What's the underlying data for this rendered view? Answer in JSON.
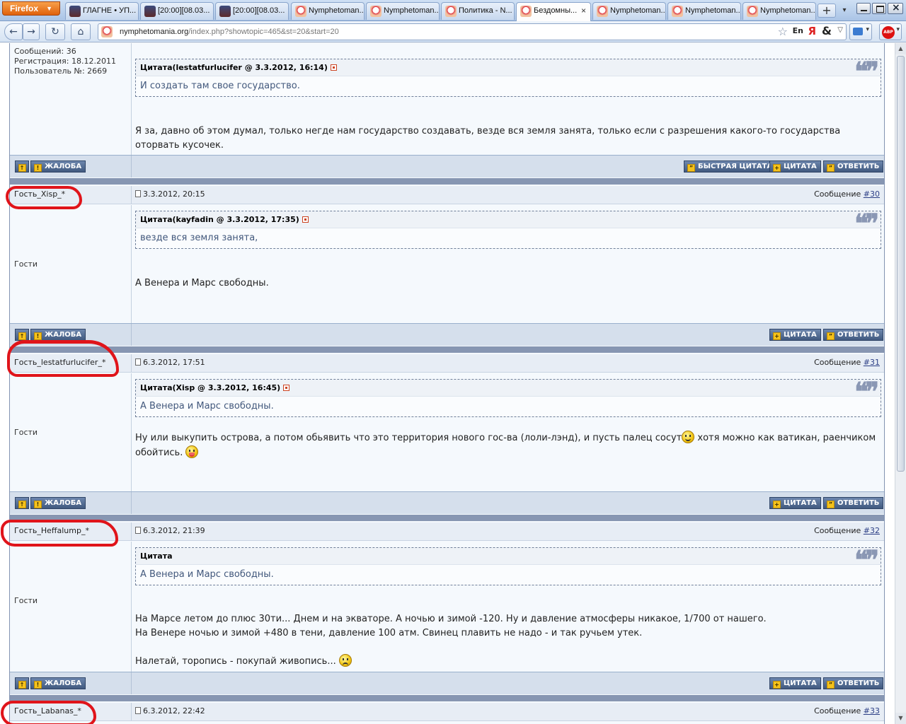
{
  "browser": {
    "firefox_label": "Firefox",
    "tabs": [
      {
        "label": "ГЛАГНЕ • УП...",
        "icon": "dark"
      },
      {
        "label": "[20:00][08.03...",
        "icon": "dark"
      },
      {
        "label": "[20:00][08.03...",
        "icon": "dark"
      },
      {
        "label": "Nymphetoman...",
        "icon": "nym"
      },
      {
        "label": "Nymphetoman...",
        "icon": "nym"
      },
      {
        "label": "Политика - N...",
        "icon": "nym"
      },
      {
        "label": "Бездомны...",
        "icon": "nym",
        "active": true
      },
      {
        "label": "Nymphetoman...",
        "icon": "nym"
      },
      {
        "label": "Nymphetoman...",
        "icon": "nym"
      },
      {
        "label": "Nymphetoman...",
        "icon": "nym"
      }
    ],
    "url_host": "nymphetomania.org",
    "url_path": "/index.php?showtopic=465&st=20&start=20",
    "en_label": "En"
  },
  "forum": {
    "prev_author": {
      "posts": "Сообщений: 36",
      "registered": "Регистрация: 18.12.2011",
      "user_no": "Пользователь №: 2669"
    },
    "prev_quote_head": "Цитата(lestatfurlucifer @ 3.3.2012, 16:14)",
    "prev_quote_text": "И создать там свое государство.",
    "prev_message": "Я за, давно об этом думал, только негде нам государство создавать, везде вся земля занята, только если с разрешения какого-то государства оторвать кусочек.",
    "buttons": {
      "report": "ЖАЛОБА",
      "fast_quote": "БЫСТРАЯ ЦИТАТА",
      "quote": "ЦИТАТА",
      "reply": "ОТВЕТИТЬ"
    },
    "group_label": "Гости",
    "message_label": "Сообщение",
    "posts": [
      {
        "author": "Гость_Xisp_*",
        "date": "3.3.2012, 20:15",
        "number": "#30",
        "quote_head": "Цитата(kayfadin @ 3.3.2012, 17:35)",
        "quote_text": "везде вся земля занята,",
        "message": "А Венера и Марс свободны."
      },
      {
        "author": "Гость_lestatfurlucifer_*",
        "date": "6.3.2012, 17:51",
        "number": "#31",
        "quote_head": "Цитата(Xisp @ 3.3.2012, 16:45)",
        "quote_text": "А Венера и Марс свободны.",
        "message_line1": "Ну или выкупить острова, а потом обьявить что это территория нового гос-ва (лоли-лэнд), и пусть палец сосут",
        "message_line1b": " хотя можно как ватикан, раенчиком",
        "message_line2": "обойтись. "
      },
      {
        "author": "Гость_Heffalump_*",
        "date": "6.3.2012, 21:39",
        "number": "#32",
        "quote_head": "Цитата",
        "quote_text": "А Венера и Марс свободны.",
        "message_line1": "На Марсе летом до плюс 30ти... Днем и на экваторе. А ночью и зимой -120. Ну и давление атмосферы никакое, 1/700 от нашего.",
        "message_line2": "На Венере ночью и зимой +480 в тени, давление 100 атм. Свинец плавить не надо - и так ручьем утек.",
        "message_line3": "Налетай, торопись - покупай живопись... "
      },
      {
        "author": "Гость_Labanas_*",
        "date": "6.3.2012, 22:42",
        "number": "#33"
      }
    ]
  }
}
